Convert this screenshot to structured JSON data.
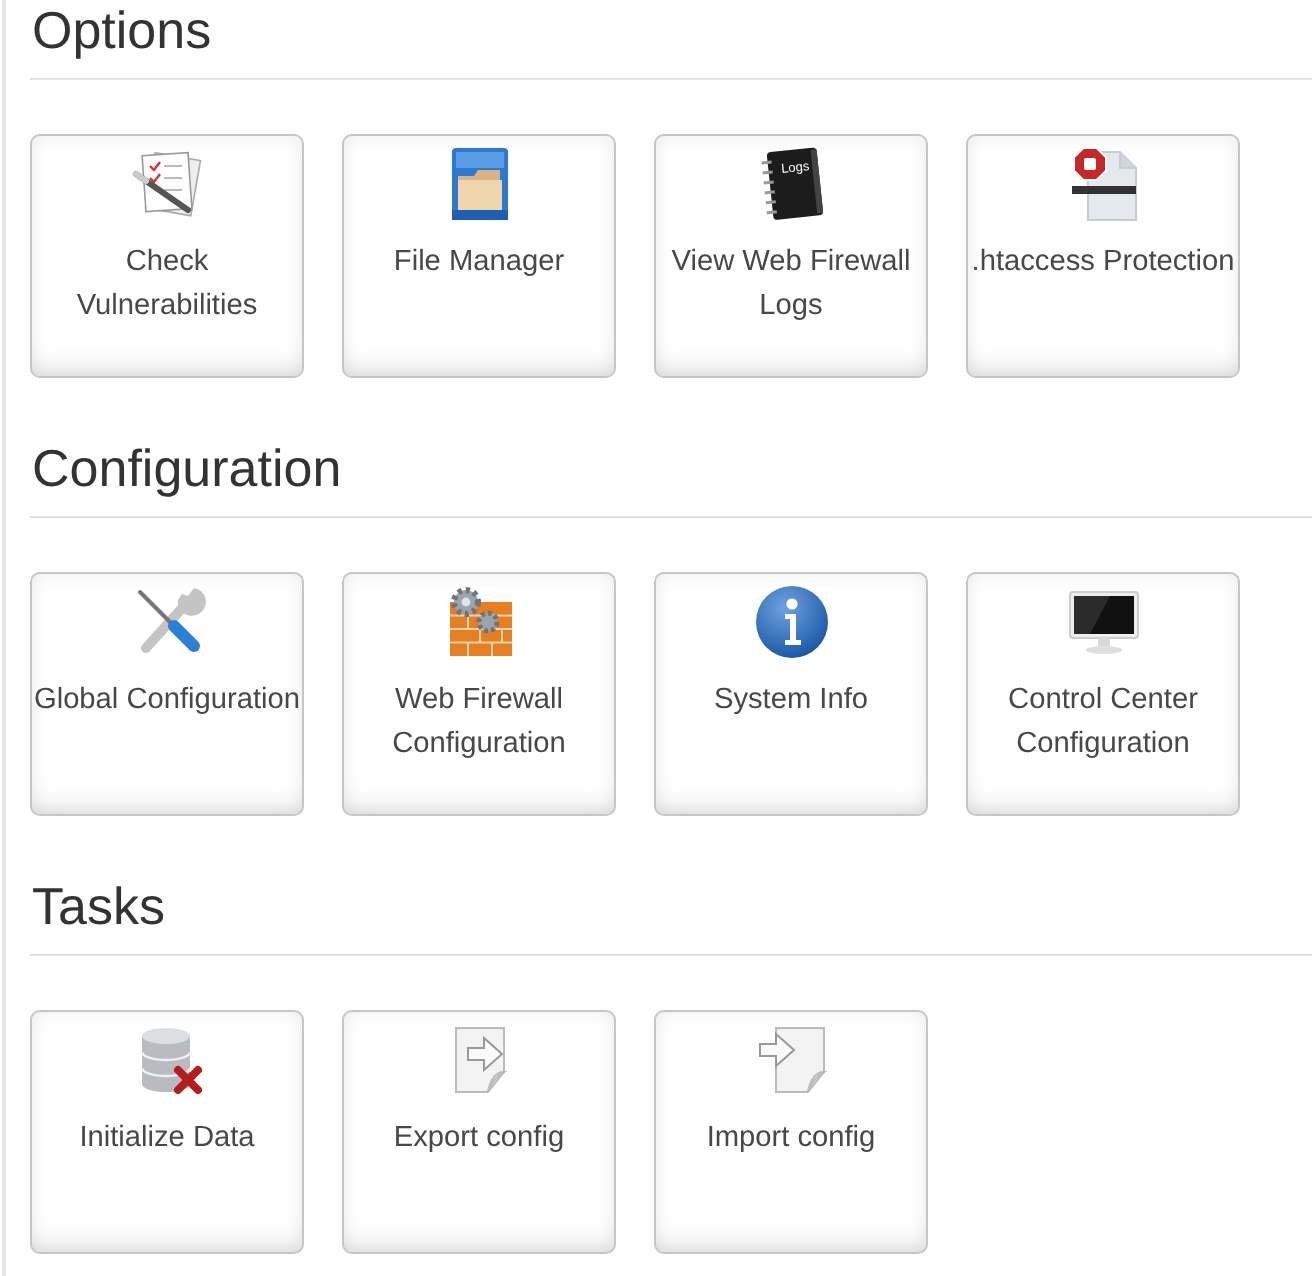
{
  "sections": [
    {
      "title": "Options",
      "shortcuts": [
        {
          "label": "Check Vulnerabilities",
          "kind": "checklist"
        },
        {
          "label": "File Manager",
          "kind": "cabinet"
        },
        {
          "label": "View Web Firewall Logs",
          "kind": "notebook",
          "icon_text": "Logs"
        },
        {
          "label": ".htaccess Protection",
          "kind": "stopdoc"
        }
      ]
    },
    {
      "title": "Configuration",
      "shortcuts": [
        {
          "label": "Global Configuration",
          "kind": "tools"
        },
        {
          "label": "Web Firewall Configuration",
          "kind": "firewall"
        },
        {
          "label": "System Info",
          "kind": "info"
        },
        {
          "label": "Control Center Configuration",
          "kind": "monitor"
        }
      ]
    },
    {
      "title": "Tasks",
      "shortcuts": [
        {
          "label": "Initialize Data",
          "kind": "dbremove"
        },
        {
          "label": "Export config",
          "kind": "export"
        },
        {
          "label": "Import config",
          "kind": "import"
        }
      ]
    }
  ]
}
